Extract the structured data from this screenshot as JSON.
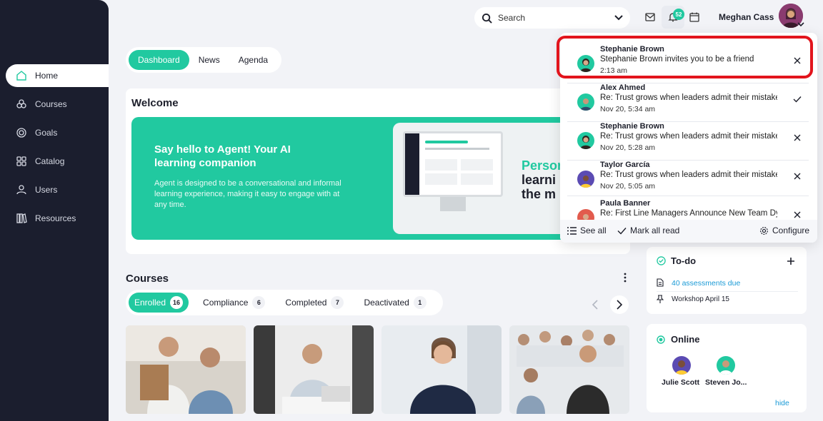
{
  "sidebar": {
    "items": [
      {
        "label": "Home",
        "icon": "home-icon",
        "active": true
      },
      {
        "label": "Courses",
        "icon": "courses-icon"
      },
      {
        "label": "Goals",
        "icon": "goals-icon"
      },
      {
        "label": "Catalog",
        "icon": "catalog-icon"
      },
      {
        "label": "Users",
        "icon": "users-icon"
      },
      {
        "label": "Resources",
        "icon": "resources-icon"
      }
    ]
  },
  "topbar": {
    "search_label": "Search",
    "notification_count": "52",
    "user_name": "Meghan Cass"
  },
  "tabs": [
    "Dashboard",
    "News",
    "Agenda"
  ],
  "welcome": {
    "title": "Welcome",
    "hero_title": "Say hello to Agent! Your AI learning companion",
    "hero_text": "Agent is designed to be a conversational and informal learning experience, making it easy to engage with at any time.",
    "hero_big_1": "Persor",
    "hero_big_2": "learni",
    "hero_big_3": "the m"
  },
  "courses": {
    "title": "Courses",
    "tabs": [
      {
        "label": "Enrolled",
        "count": "16"
      },
      {
        "label": "Compliance",
        "count": "6"
      },
      {
        "label": "Completed",
        "count": "7"
      },
      {
        "label": "Deactivated",
        "count": "1"
      }
    ]
  },
  "todo": {
    "title": "To-do",
    "items": [
      "40 assessments due",
      "Workshop April 15"
    ]
  },
  "online": {
    "title": "Online",
    "users": [
      "Julie Scott",
      "Steven Jo..."
    ],
    "hide_label": "hide"
  },
  "notifications": {
    "items": [
      {
        "name": "Stephanie Brown",
        "message": "Stephanie Brown invites you to be a friend",
        "time": "2:13 am",
        "action": "close"
      },
      {
        "name": "Alex Ahmed",
        "message": "Re: Trust grows when leaders admit their mistakes",
        "time": "Nov 20, 5:34 am",
        "action": "check"
      },
      {
        "name": "Stephanie Brown",
        "message": "Re: Trust grows when leaders admit their mistakes",
        "time": "Nov 20, 5:28 am",
        "action": "close"
      },
      {
        "name": "Taylor García",
        "message": "Re: Trust grows when leaders admit their mistakes",
        "time": "Nov 20, 5:05 am",
        "action": "close"
      },
      {
        "name": "Paula Banner",
        "message": "Re: First Line Managers Announce New Team Dynamics",
        "time": "",
        "action": "close"
      }
    ],
    "see_all": "See all",
    "mark_all_read": "Mark all read",
    "configure": "Configure"
  },
  "colors": {
    "accent": "#21c9a0",
    "sidebar": "#1b1e2e",
    "highlight": "#e2141c"
  }
}
